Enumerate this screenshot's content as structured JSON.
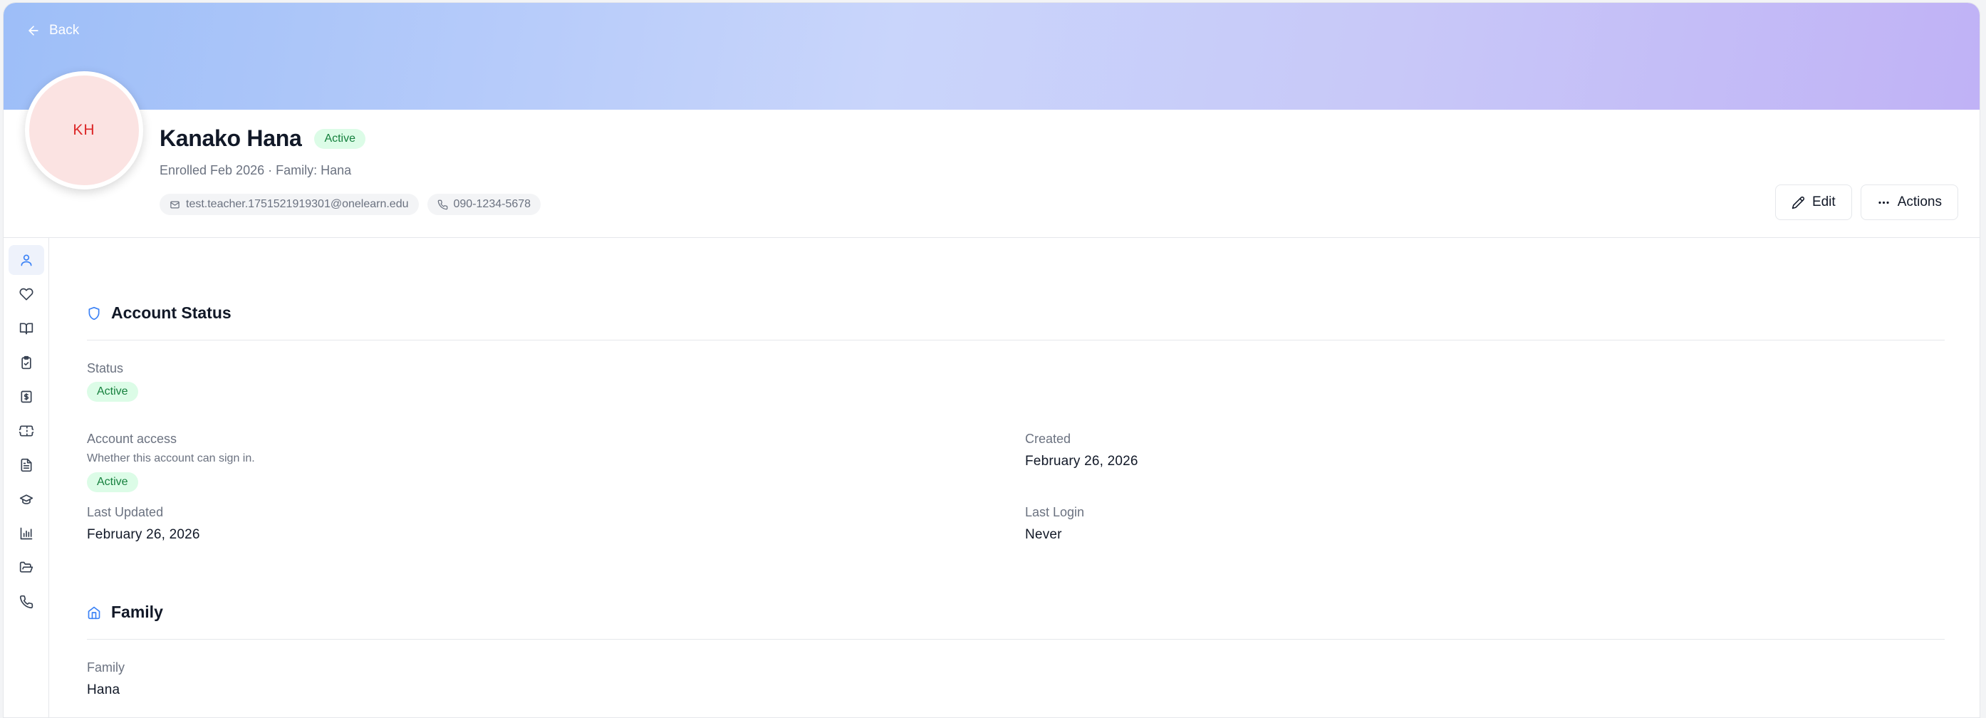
{
  "header": {
    "back_label": "Back",
    "avatar_initials": "KH",
    "name": "Kanako Hana",
    "status_badge": "Active",
    "subline": "Enrolled Feb 2026 · Family: Hana",
    "email": "test.teacher.1751521919301@onelearn.edu",
    "phone": "090-1234-5678"
  },
  "actions": {
    "edit_label": "Edit",
    "actions_label": "Actions"
  },
  "sidebar": {
    "items": [
      {
        "icon": "user-icon",
        "active": true
      },
      {
        "icon": "heart-icon"
      },
      {
        "icon": "book-open-icon"
      },
      {
        "icon": "clipboard-check-icon"
      },
      {
        "icon": "dollar-receipt-icon"
      },
      {
        "icon": "ticket-icon"
      },
      {
        "icon": "file-text-icon"
      },
      {
        "icon": "graduation-cap-icon"
      },
      {
        "icon": "bar-chart-icon"
      },
      {
        "icon": "folder-open-icon"
      },
      {
        "icon": "phone-icon"
      }
    ]
  },
  "account_status": {
    "title": "Account Status",
    "status_label": "Status",
    "status_value": "Active",
    "access_label": "Account access",
    "access_help": "Whether this account can sign in.",
    "access_value": "Active",
    "created_label": "Created",
    "created_value": "February 26, 2026",
    "updated_label": "Last Updated",
    "updated_value": "February 26, 2026",
    "login_label": "Last Login",
    "login_value": "Never"
  },
  "family": {
    "title": "Family",
    "family_label": "Family",
    "family_value": "Hana"
  },
  "colors": {
    "accent": "#3b82f6",
    "badge_bg": "#dcfce7",
    "badge_text": "#15803d",
    "avatar_bg": "#fbe3e2",
    "avatar_text": "#dc2626"
  }
}
